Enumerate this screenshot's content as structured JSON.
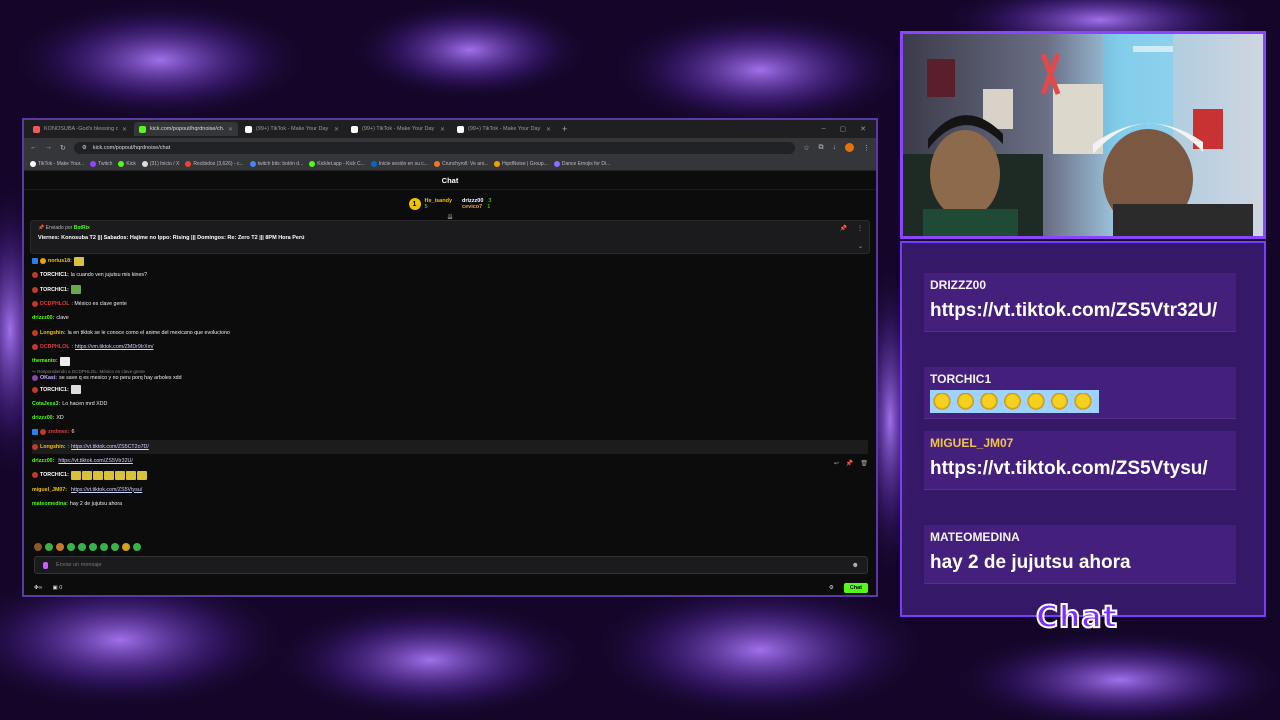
{
  "browser": {
    "tabs": [
      {
        "title": "KONOSUBA -God's blessing on...",
        "color": "#f05a5a",
        "active": false
      },
      {
        "title": "kick.com/popout/hqrdnoise/ch...",
        "color": "#53fc18",
        "active": true
      },
      {
        "title": "(99+) TikTok - Make Your Day",
        "color": "#ffffff",
        "active": false
      },
      {
        "title": "(99+) TikTok - Make Your Day",
        "color": "#ffffff",
        "active": false
      },
      {
        "title": "(99+) TikTok - Make Your Day",
        "color": "#ffffff",
        "active": false
      }
    ],
    "url": "kick.com/popout/hqrdnoise/chat",
    "bookmarks": [
      {
        "label": "TikTok - Make Your...",
        "color": "#ffffff"
      },
      {
        "label": "Twitch",
        "color": "#9146ff"
      },
      {
        "label": "Kick",
        "color": "#53fc18"
      },
      {
        "label": "(31) Inicio / X",
        "color": "#dddddd"
      },
      {
        "label": "Recibidos (3,626) - c...",
        "color": "#ea4335"
      },
      {
        "label": "twitch bits: botón d...",
        "color": "#4285f4"
      },
      {
        "label": "Kicklet.app - Kick C...",
        "color": "#53fc18"
      },
      {
        "label": "Inicie sesión en su c...",
        "color": "#0a66c2"
      },
      {
        "label": "Crunchyroll: Ve ani...",
        "color": "#f47521"
      },
      {
        "label": "HqrdNoise | Group...",
        "color": "#f4a100"
      },
      {
        "label": "Dance Emojis for Di...",
        "color": "#8a6cff"
      }
    ]
  },
  "chat": {
    "header": "Chat",
    "gifters": {
      "first": {
        "rank": "1",
        "name": "He_isandy",
        "count": "5"
      },
      "second": {
        "name": "drizzz00",
        "count": "3"
      },
      "third": {
        "name": "cevico7",
        "count": "1"
      }
    },
    "pinned": {
      "by_label": "Enviado por",
      "by_user": "BotRix",
      "text": "Viernes: Konosuba T2 ||| Sabados: Hajime no Ippo: Rising ||| Domingos: Re: Zero T2 ||| 8PM Hora Perú"
    },
    "messages": [
      {
        "user": "norius18:",
        "color": "#f2c200",
        "text": "",
        "emote": true
      },
      {
        "user": "TORCHIC1:",
        "color": "#ffffff",
        "text": " la cuando ven jujutsu mis kines?"
      },
      {
        "user": "TORCHIC1:",
        "color": "#ffffff",
        "text": "",
        "emote": true
      },
      {
        "user": "DCDPHLOL",
        "color": "#e03c3c",
        "text": ": México es clave gente"
      },
      {
        "user": "drizzz00:",
        "color": "#53fc18",
        "text": " clave"
      },
      {
        "user": "Longshin:",
        "color": "#f2c200",
        "text": " la en tiktok se le conoce como el anime del mexicano que evoluciono"
      },
      {
        "user": "DCDPHLOL",
        "color": "#e03c3c",
        "text": ": ",
        "link": "https://vm.tiktok.com/ZMDr9IrXm/"
      },
      {
        "user": "themanto:",
        "color": "#53fc18",
        "text": "",
        "emote": true
      },
      {
        "reply": "Respondiendo a DCDPHLOL: México es clave gente",
        "user": "OKasi:",
        "color": "#c9a7ff",
        "text": " se save q es mexico y no peru porq hay arboles xdd"
      },
      {
        "user": "TORCHIC1:",
        "color": "#ffffff",
        "text": "",
        "emote": true
      },
      {
        "user": "CotaJess3:",
        "color": "#53fc18",
        "text": " Lo hacen mrd XDD"
      },
      {
        "user": "drizzz00:",
        "color": "#53fc18",
        "text": " XD"
      },
      {
        "user": "zndmex:",
        "color": "#e03c3c",
        "text": " 6"
      },
      {
        "user": "Longshin:",
        "color": "#f2c200",
        "text": ": ",
        "link": "https://vt.tiktok.com/ZS5CT2o7D/"
      },
      {
        "user": "drizzz00:",
        "color": "#53fc18",
        "text": " ",
        "link": "https://vt.tiktok.com/ZS5Vtr32U/"
      },
      {
        "user": "TORCHIC1:",
        "color": "#ffffff",
        "text": "",
        "emotes": 7
      },
      {
        "user": "miguel_JM07:",
        "color": "#f2c200",
        "text": " ",
        "link": "https://vt.tiktok.com/ZS5Vtysu/"
      },
      {
        "user": "mateomedina:",
        "color": "#53fc18",
        "text": " hay 2 de jujutsu ahora"
      }
    ],
    "input_placeholder": "Enviar un mensaje",
    "points": "0",
    "send_label": "Chat"
  },
  "overlay": {
    "messages": [
      {
        "user": "DRIZZZ00",
        "user_color": "#f2f2f2",
        "text": "https://vt.tiktok.com/ZS5Vtr32U/"
      },
      {
        "user": "TORCHIC1",
        "user_color": "#f2f2f2",
        "emotes": 7
      },
      {
        "user": "MIGUEL_JM07",
        "user_color": "#f2c34a",
        "text": "https://vt.tiktok.com/ZS5Vtysu/"
      },
      {
        "user": "MATEOMEDINA",
        "user_color": "#f2f2f2",
        "text": "hay 2 de jujutsu ahora"
      }
    ],
    "logo": "Chat"
  },
  "colors": {
    "kick_green": "#53fc18",
    "accent_purple": "#7b2cff"
  }
}
